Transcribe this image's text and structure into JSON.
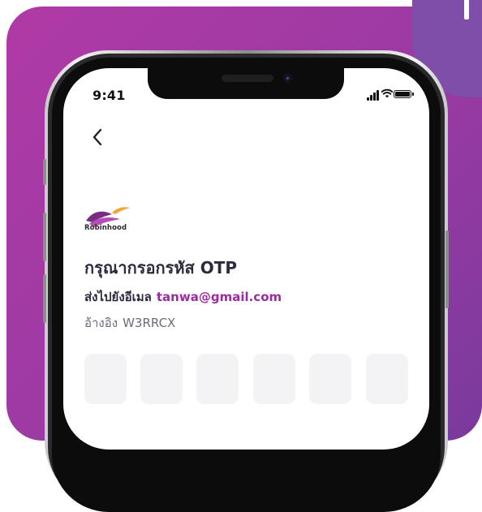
{
  "status_bar": {
    "time": "9:41"
  },
  "header": {
    "back_icon": "chevron-left-icon"
  },
  "brand": {
    "name": "Robinhood",
    "colors": {
      "purple": "#7b2b85",
      "gold": "#f1a83a"
    }
  },
  "content": {
    "title": "กรุณากรอกรหัส OTP",
    "sent_to_label": "ส่งไปยังอีเมล",
    "email": "tanwa@gmail.com",
    "reference_label": "อ้างอิง",
    "reference_code": "W3RRCX"
  },
  "otp": {
    "digits": [
      "",
      "",
      "",
      "",
      "",
      ""
    ]
  },
  "colors": {
    "background": "#a63aa4",
    "accent": "#9b2d9f",
    "text": "#2d2a3e",
    "muted_text": "#6d6a7c",
    "otp_box": "#f3f3f5"
  }
}
